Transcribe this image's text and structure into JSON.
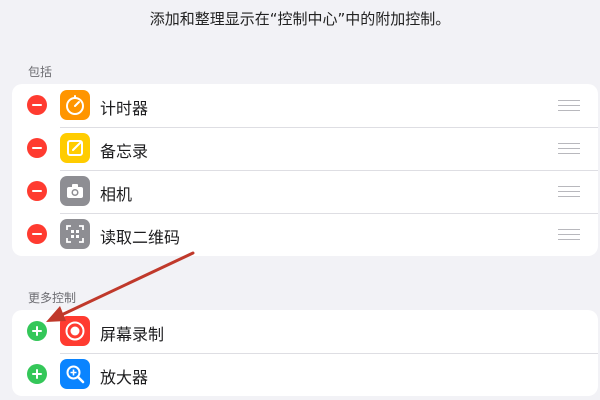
{
  "description": "添加和整理显示在“控制中心”中的附加控制。",
  "included": {
    "header": "包括",
    "items": [
      {
        "label": "计时器",
        "icon": "timer-icon",
        "color": "#ff9500"
      },
      {
        "label": "备忘录",
        "icon": "notes-icon",
        "color": "#ffcc00"
      },
      {
        "label": "相机",
        "icon": "camera-icon",
        "color": "#8e8e93"
      },
      {
        "label": "读取二维码",
        "icon": "qr-code-icon",
        "color": "#8e8e93"
      }
    ]
  },
  "more": {
    "header": "更多控制",
    "items": [
      {
        "label": "屏幕录制",
        "icon": "screen-record-icon",
        "color": "#ff3b30"
      },
      {
        "label": "放大器",
        "icon": "magnifier-icon",
        "color": "#0a84ff"
      }
    ]
  },
  "colors": {
    "remove": "#ff3b30",
    "add": "#34c759",
    "annotation_arrow": "#c0392b",
    "background": "#f2f2f6"
  }
}
